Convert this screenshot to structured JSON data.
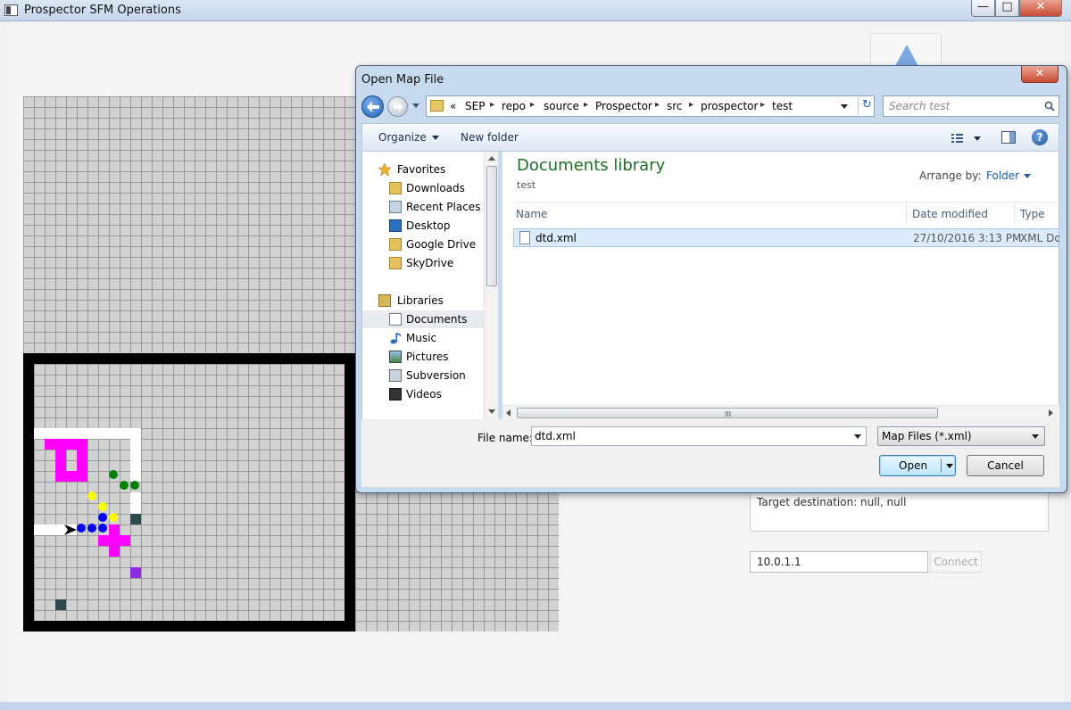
{
  "app": {
    "title": "Prospector SFM Operations",
    "window_buttons": {
      "minimize": "—",
      "maximize": "□",
      "close": "✕"
    },
    "status": {
      "target_destination": "Target destination:  null, null"
    },
    "connection": {
      "ip_value": "10.0.1.1",
      "connect_label": "Connect"
    },
    "map": {
      "colors": {
        "grid_bg": "#d2d2d2",
        "grid_line": "#9a9a9a",
        "wall": "#ffffff",
        "obstacle": "#ff00ff",
        "frame": "#000000"
      }
    }
  },
  "dialog": {
    "title": "Open Map File",
    "close_label": "✕",
    "breadcrumb": {
      "overflow": "«",
      "parts": [
        "SEP",
        "repo",
        "source",
        "Prospector",
        "src",
        "prospector",
        "test"
      ]
    },
    "search_placeholder": "Search test",
    "toolbar": {
      "organize_label": "Organize",
      "new_folder_label": "New folder",
      "help_label": "?"
    },
    "nav": {
      "favorites_header": "Favorites",
      "favorites": [
        "Downloads",
        "Recent Places",
        "Desktop",
        "Google Drive",
        "SkyDrive"
      ],
      "libraries_header": "Libraries",
      "libraries": [
        "Documents",
        "Music",
        "Pictures",
        "Subversion",
        "Videos"
      ],
      "selected": "Documents"
    },
    "content": {
      "library_title": "Documents library",
      "library_subtitle": "test",
      "arrange_label": "Arrange by:",
      "arrange_value": "Folder",
      "columns": [
        "Name",
        "Date modified",
        "Type"
      ],
      "files": [
        {
          "name": "dtd.xml",
          "date": "27/10/2016 3:13 PM",
          "type": "XML Document"
        }
      ],
      "scroll_grip": "III"
    },
    "footer": {
      "file_name_label": "File name:",
      "file_name_value": "dtd.xml",
      "file_type_value": "Map Files (*.xml)",
      "open_label": "Open",
      "cancel_label": "Cancel"
    }
  }
}
